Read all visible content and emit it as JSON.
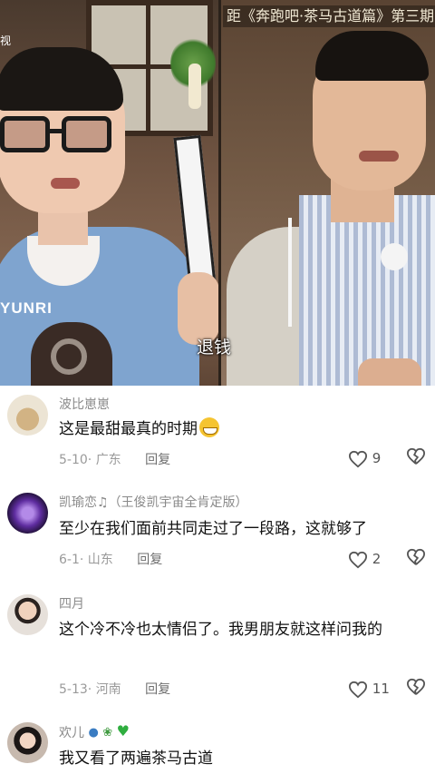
{
  "video": {
    "top_caption": "距《奔跑吧·茶马古道篇》第三期",
    "left_partial_label": "视",
    "shirt_text": "YUNRI",
    "subtitle": "退钱"
  },
  "comments": [
    {
      "username": "波比崽崽",
      "text": "这是最甜最真的时期",
      "date": "5-10",
      "location": "广东",
      "reply_label": "回复",
      "likes": "9"
    },
    {
      "username": "凯瑜恋♫（王俊凯宇宙全肯定版）",
      "text": "至少在我们面前共同走过了一段路，这就够了",
      "date": "6-1",
      "location": "山东",
      "reply_label": "回复",
      "likes": "2"
    },
    {
      "username": "四月",
      "text": "这个冷不冷也太情侣了。我男朋友就这样问我的",
      "date": "5-13",
      "location": "河南",
      "reply_label": "回复",
      "likes": "11"
    },
    {
      "username": "欢儿",
      "text": "我又看了两遍茶马古道"
    }
  ],
  "icons": {
    "like": "heart-outline-icon",
    "dislike": "broken-heart-outline-icon",
    "grin_emoji": "grinning-face-emoji",
    "name_decorations": [
      "fish-icon",
      "leaf-icon",
      "green-heart-icon"
    ]
  },
  "colors": {
    "username": "#8a8a8a",
    "comment_text": "#111111",
    "meta": "#9a9a9a"
  }
}
